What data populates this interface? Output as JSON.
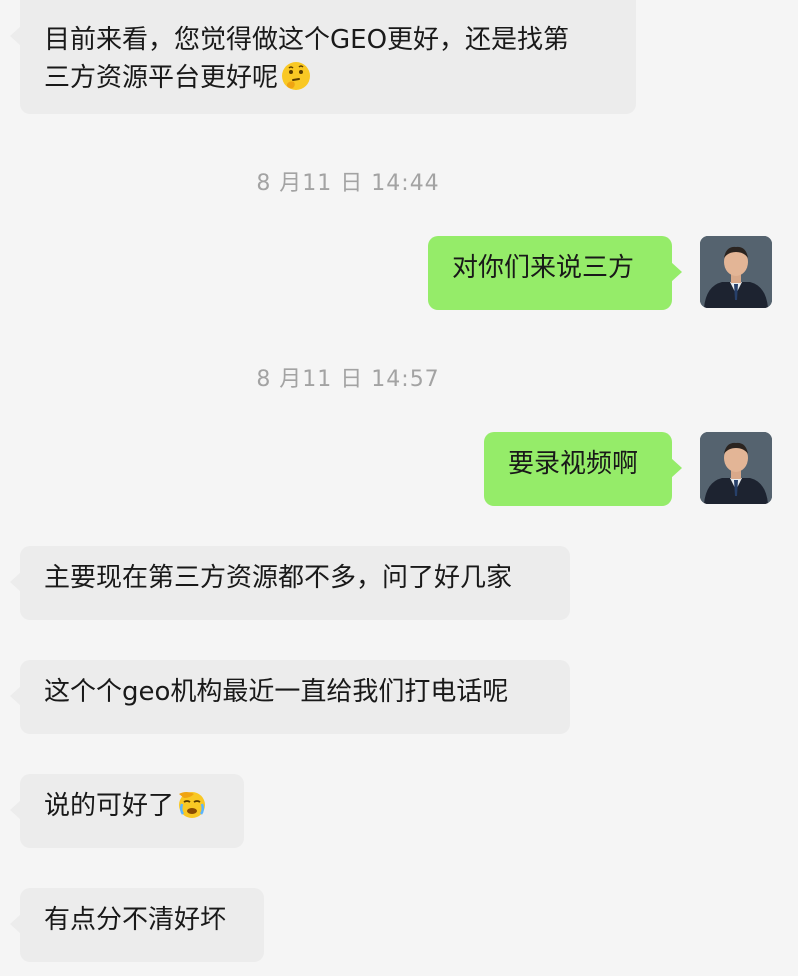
{
  "messages": [
    {
      "kind": "incoming",
      "line1": "目前来看，您觉得做这个GEO更好，还是找第",
      "line2": "三方资源平台更好呢",
      "emoji": "thinking-face-icon"
    },
    {
      "kind": "time",
      "text": "8 月11 日 14:44"
    },
    {
      "kind": "outgoing",
      "text": "对你们来说三方"
    },
    {
      "kind": "time",
      "text": "8 月11 日 14:57"
    },
    {
      "kind": "outgoing",
      "text": "要录视频啊"
    },
    {
      "kind": "incoming",
      "text": "主要现在第三方资源都不多，问了好几家"
    },
    {
      "kind": "incoming",
      "text": "这个个geo机构最近一直给我们打电话呢"
    },
    {
      "kind": "incoming",
      "text": "说的可好了",
      "emoji": "face-palm-icon"
    },
    {
      "kind": "incoming",
      "text": "有点分不清好坏"
    }
  ],
  "colors": {
    "background": "#f5f5f5",
    "incoming_bubble": "#ececec",
    "outgoing_bubble": "#95ec69",
    "timestamp": "#a3a3a3"
  }
}
